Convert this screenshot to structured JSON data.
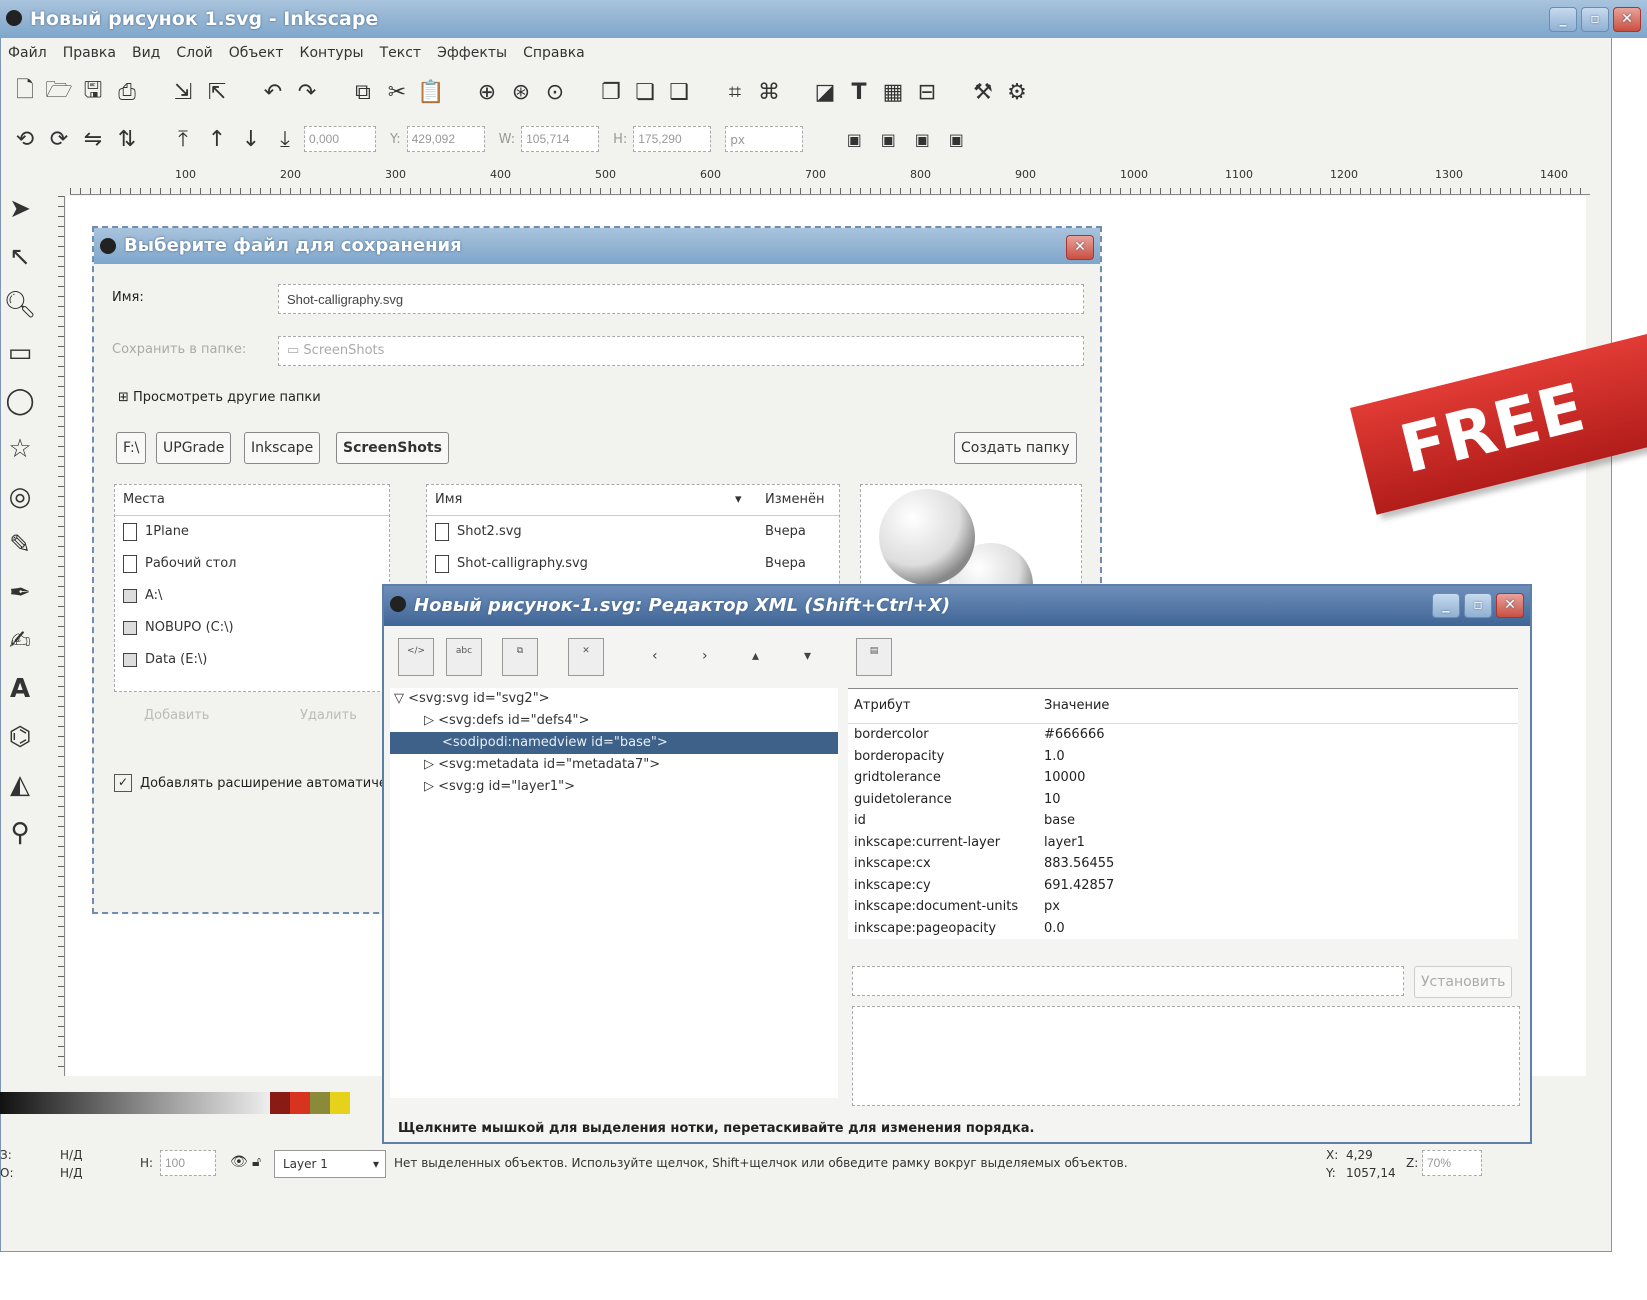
{
  "window": {
    "title": "Новый рисунок 1.svg - Inkscape",
    "buttons": [
      "_",
      "▫",
      "✕"
    ]
  },
  "menubar": [
    "Файл",
    "Правка",
    "Вид",
    "Слой",
    "Объект",
    "Контуры",
    "Текст",
    "Эффекты",
    "Справка"
  ],
  "toolbar2": {
    "x": "0,000",
    "y": "429,092",
    "w": "105,714",
    "h": "175,290",
    "unit": "px",
    "y_label": "Y:",
    "w_label": "W:",
    "h_label": "H:"
  },
  "ruler": {
    "labels": [
      "100",
      "200",
      "300",
      "400",
      "500",
      "600",
      "700",
      "800",
      "900",
      "1000",
      "1100",
      "1200",
      "1300",
      "1400"
    ]
  },
  "badge": {
    "text": "FREE"
  },
  "save_dialog": {
    "title": "Выберите файл для сохранения",
    "name_label": "Имя:",
    "name_value": "Shot-calligraphy.svg",
    "save_in_label": "Сохранить в папке:",
    "save_in_value": "ScreenShots",
    "browse_label": "Просмотреть другие папки",
    "path_buttons": [
      "F:\\",
      "UPGrade",
      "Inkscape",
      "ScreenShots"
    ],
    "create_folder": "Создать папку",
    "places_header": "Места",
    "places": [
      "1Plane",
      "Рабочий стол",
      "A:\\",
      "NOBUPO (C:\\)",
      "Data (E:\\)"
    ],
    "add_button": "Добавить",
    "remove_button": "Удалить",
    "files_header_name": "Имя",
    "files_header_changed": "Изменён",
    "files": [
      {
        "name": "Shot2.svg",
        "changed": "Вчера"
      },
      {
        "name": "Shot-calligraphy.svg",
        "changed": "Вчера"
      }
    ],
    "extension_label": "Добавлять расширение автоматически"
  },
  "xml_editor": {
    "title": "Новый рисунок-1.svg: Редактор XML (Shift+Ctrl+X)",
    "tree": [
      {
        "text": "<svg:svg id=\"svg2\">",
        "indent": 0,
        "arrow": "▽"
      },
      {
        "text": "<svg:defs id=\"defs4\">",
        "indent": 1,
        "arrow": "▷"
      },
      {
        "text": "<sodipodi:namedview id=\"base\">",
        "indent": 1,
        "arrow": ""
      },
      {
        "text": "<svg:metadata id=\"metadata7\">",
        "indent": 1,
        "arrow": "▷"
      },
      {
        "text": "<svg:g id=\"layer1\">",
        "indent": 1,
        "arrow": "▷"
      }
    ],
    "attr_header": "Атрибут",
    "value_header": "Значение",
    "attributes": [
      {
        "name": "bordercolor",
        "value": "#666666"
      },
      {
        "name": "borderopacity",
        "value": "1.0"
      },
      {
        "name": "gridtolerance",
        "value": "10000"
      },
      {
        "name": "guidetolerance",
        "value": "10"
      },
      {
        "name": "id",
        "value": "base"
      },
      {
        "name": "inkscape:current-layer",
        "value": "layer1"
      },
      {
        "name": "inkscape:cx",
        "value": "883.56455"
      },
      {
        "name": "inkscape:cy",
        "value": "691.42857"
      },
      {
        "name": "inkscape:document-units",
        "value": "px"
      },
      {
        "name": "inkscape:pageopacity",
        "value": "0.0"
      }
    ],
    "set_button": "Установить",
    "status": "Щелкните мышкой для выделения нотки, перетаскивайте для изменения порядка."
  },
  "statusbar": {
    "fill_label": "З:",
    "stroke_label": "О:",
    "fill_value": "Н/Д",
    "stroke_value": "Н/Д",
    "opacity_label": "Н:",
    "opacity_value": "100",
    "layer": "Layer 1",
    "message": "Нет выделенных объектов. Используйте щелчок, Shift+щелчок или обведите рамку вокруг выделяемых объектов.",
    "x_label": "X:",
    "x_value": "4,29",
    "y_label": "Y:",
    "y_value": "1057,14",
    "zoom_label": "Z:",
    "zoom": "70%"
  },
  "colors": {
    "title_grad_top": "#a9c3dc",
    "title_grad_bottom": "#7ea6cb",
    "selection": "#3d6189",
    "badge_red": "#d42e29"
  }
}
